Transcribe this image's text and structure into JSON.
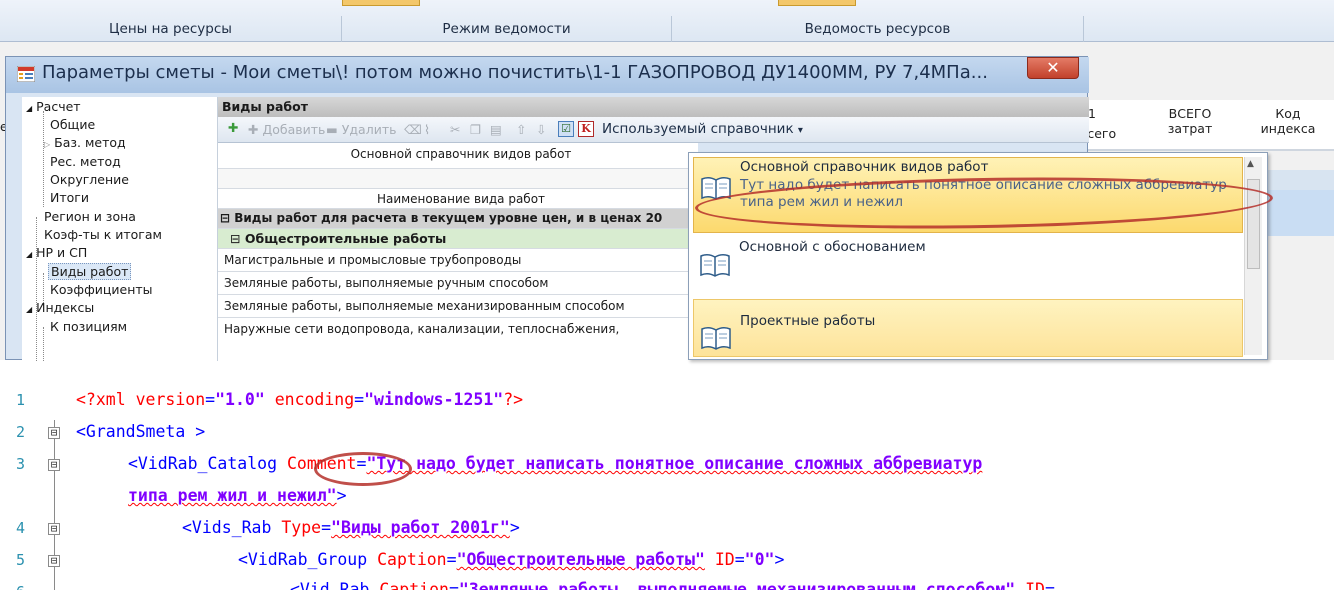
{
  "ribbon": {
    "tabs": [
      "Цены на ресурсы",
      "Режим ведомости",
      "Ведомость ресурсов"
    ]
  },
  "background_grid": {
    "col1_number": "1",
    "col1_sub": "всего",
    "col2": [
      "ВСЕГО",
      "затрат"
    ],
    "col3": [
      "Код",
      "индекса"
    ],
    "left_char": "е,"
  },
  "dialog": {
    "title": "Параметры сметы - Мои сметы\\! потом можно почистить\\1-1 ГАЗОПРОВОД ДУ1400ММ, РУ 7,4МПа...",
    "close_glyph": "✕",
    "tree": [
      {
        "label": "Расчет",
        "glyph": "◢"
      },
      {
        "label": "Общие"
      },
      {
        "label": "Баз. метод",
        "glyph": "▷"
      },
      {
        "label": "Рес. метод"
      },
      {
        "label": "Округление"
      },
      {
        "label": "Итоги"
      },
      {
        "label": "Регион и зона"
      },
      {
        "label": "Коэф-ты к итогам"
      },
      {
        "label": "НР и СП",
        "glyph": "◢"
      },
      {
        "label": "Виды работ"
      },
      {
        "label": "Коэффициенты"
      },
      {
        "label": "Индексы",
        "glyph": "◢"
      },
      {
        "label": "К позициям"
      }
    ],
    "section_header": "Виды работ",
    "toolbar": {
      "add": "Добавить",
      "delete": "Удалить",
      "catalog_menu": "Используемый справочник",
      "catalog_caret": "▾",
      "k_icon": "K"
    },
    "grid": {
      "header1": "Основной справочник видов работ",
      "header3": "Наименование вида работ",
      "row_group": "Виды работ для расчета в текущем уровне цен, и в ценах 20",
      "row_subgroup": "Общестроительные работы",
      "rows": [
        "Магистральные и промысловые трубопроводы",
        "Земляные работы, выполняемые ручным способом",
        "Земляные работы, выполняемые механизированным способом",
        "Наружные сети водопровода, канализации, теплоснабжения,"
      ],
      "expand_glyph": "⊟"
    },
    "dropdown": {
      "items": [
        {
          "title": "Основной справочник видов работ",
          "desc": "Тут надо будет написать понятное описание сложных аббревиатур типа рем жил и нежил"
        },
        {
          "title": "Основной с обоснованием",
          "desc": ""
        },
        {
          "title": "Проектные работы",
          "desc": ""
        }
      ]
    }
  },
  "code": {
    "line_numbers": [
      "1",
      "2",
      "3",
      "4",
      "5",
      "6"
    ],
    "fold_glyph": "⊟",
    "l1": {
      "open": "<?xml ",
      "a1": "version",
      "eq1": "=",
      "v1": "\"1.0\"",
      "a2": " encoding",
      "eq2": "=",
      "v2": "\"windows-1251\"",
      "close": "?>"
    },
    "l2": {
      "text": "<GrandSmeta >"
    },
    "l3": {
      "tag": "<VidRab_Catalog ",
      "attr": "Comment",
      "eq": "=",
      "v1": "\"Тут надо будет написать понятное описание сложных аббревиатур"
    },
    "l3b": {
      "v2": "типа рем жил и нежил\"",
      "close": ">"
    },
    "l4": {
      "tag": "<Vids_Rab ",
      "attr": "Type",
      "eq": "=",
      "val": "\"Виды работ 2001г\"",
      "close": ">"
    },
    "l5": {
      "tag": "<VidRab_Group ",
      "attr1": "Caption",
      "eq1": "=",
      "val1": "\"Общестроительные работы\"",
      "attr2": " ID",
      "eq2": "=",
      "val2": "\"0\"",
      "close": ">"
    },
    "l6": {
      "tag": "<Vid_Rab ",
      "attr1": "Caption",
      "eq1": "=",
      "val1": "\"Земляные работы, выполняемые механизированным способом\"",
      "attr2": " ID",
      "eq2": "="
    }
  },
  "colors": {
    "xml_tag": "#0000ff",
    "xml_attr": "#ff0000",
    "xml_value": "#8000ff",
    "annotation_oval": "#b5302a",
    "dropdown_highlight": "#fcd96e"
  }
}
